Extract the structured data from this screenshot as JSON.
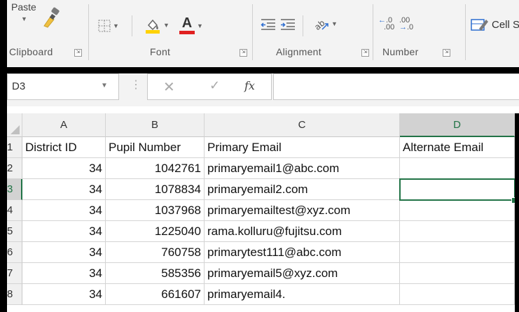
{
  "ribbon": {
    "clipboard": {
      "paste_label": "Paste",
      "group_label": "Clipboard"
    },
    "font": {
      "group_label": "Font",
      "font_color_letter": "A"
    },
    "alignment": {
      "group_label": "Alignment"
    },
    "number": {
      "group_label": "Number",
      "increase_decimal": ".0",
      "decrease_decimal": ".00"
    },
    "styles": {
      "cell_styles_label": "Cell S"
    },
    "launcher_glyph": "⇲"
  },
  "formula_bar": {
    "name_box": "D3",
    "fx_label": "fx",
    "formula_value": ""
  },
  "sheet": {
    "columns": [
      "A",
      "B",
      "C",
      "D"
    ],
    "header_row": [
      "District ID",
      "Pupil Number",
      "Primary Email",
      "Alternate Email"
    ],
    "rows": [
      {
        "num": "1"
      },
      {
        "num": "2",
        "district": "34",
        "pupil": "1042761",
        "primary": "primaryemail1@abc.com",
        "alternate": ""
      },
      {
        "num": "3",
        "district": "34",
        "pupil": "1078834",
        "primary": "primaryemail2.com",
        "alternate": ""
      },
      {
        "num": "4",
        "district": "34",
        "pupil": "1037968",
        "primary": "primaryemailtest@xyz.com",
        "alternate": ""
      },
      {
        "num": "5",
        "district": "34",
        "pupil": "1225040",
        "primary": "rama.kolluru@fujitsu.com",
        "alternate": ""
      },
      {
        "num": "6",
        "district": "34",
        "pupil": "760758",
        "primary": "primarytest111@abc.com",
        "alternate": ""
      },
      {
        "num": "7",
        "district": "34",
        "pupil": "585356",
        "primary": "primaryemail5@xyz.com",
        "alternate": ""
      },
      {
        "num": "8",
        "district": "34",
        "pupil": "661607",
        "primary": "primaryemail4.",
        "alternate": ""
      }
    ],
    "active_cell": "D3",
    "accent_color": "#217346"
  }
}
